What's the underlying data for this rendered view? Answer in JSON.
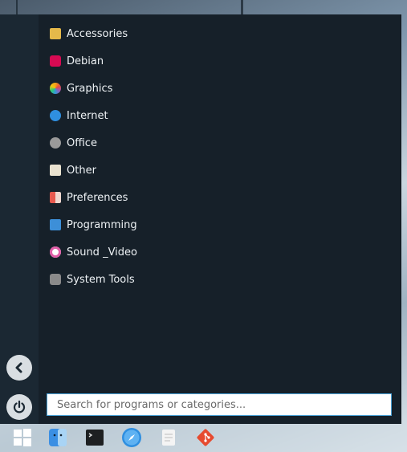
{
  "menu": {
    "categories": [
      {
        "label": "Accessories",
        "icon": "accessories-icon",
        "color": "#e6b94a"
      },
      {
        "label": "Debian",
        "icon": "debian-icon",
        "color": "#d70a53"
      },
      {
        "label": "Graphics",
        "icon": "graphics-icon",
        "color": "#f3a21b"
      },
      {
        "label": "Internet",
        "icon": "internet-icon",
        "color": "#2f8fe0"
      },
      {
        "label": "Office",
        "icon": "office-icon",
        "color": "#9a9a9a"
      },
      {
        "label": "Other",
        "icon": "other-icon",
        "color": "#e9e2d0"
      },
      {
        "label": "Preferences",
        "icon": "preferences-icon",
        "color": "#e85a4f"
      },
      {
        "label": "Programming",
        "icon": "programming-icon",
        "color": "#3d8fd8"
      },
      {
        "label": "Sound _Video",
        "icon": "sound-video-icon",
        "color": "#e05ea8"
      },
      {
        "label": "System Tools",
        "icon": "system-tools-icon",
        "color": "#8a8a8a"
      }
    ],
    "back_icon": "back-arrow-icon",
    "power_icon": "power-icon",
    "search": {
      "placeholder": "Search for programs or categories..."
    }
  },
  "taskbar": {
    "items": [
      {
        "name": "start-menu-button",
        "icon": "windows-logo-icon"
      },
      {
        "name": "finder-button",
        "icon": "finder-icon"
      },
      {
        "name": "terminal-button",
        "icon": "terminal-icon"
      },
      {
        "name": "browser-button",
        "icon": "compass-icon"
      },
      {
        "name": "notes-button",
        "icon": "notepad-icon"
      },
      {
        "name": "git-button",
        "icon": "git-icon"
      }
    ]
  },
  "colors": {
    "panel": "#162029",
    "sidebar": "#1b2833",
    "accent": "#4aa3d8"
  }
}
